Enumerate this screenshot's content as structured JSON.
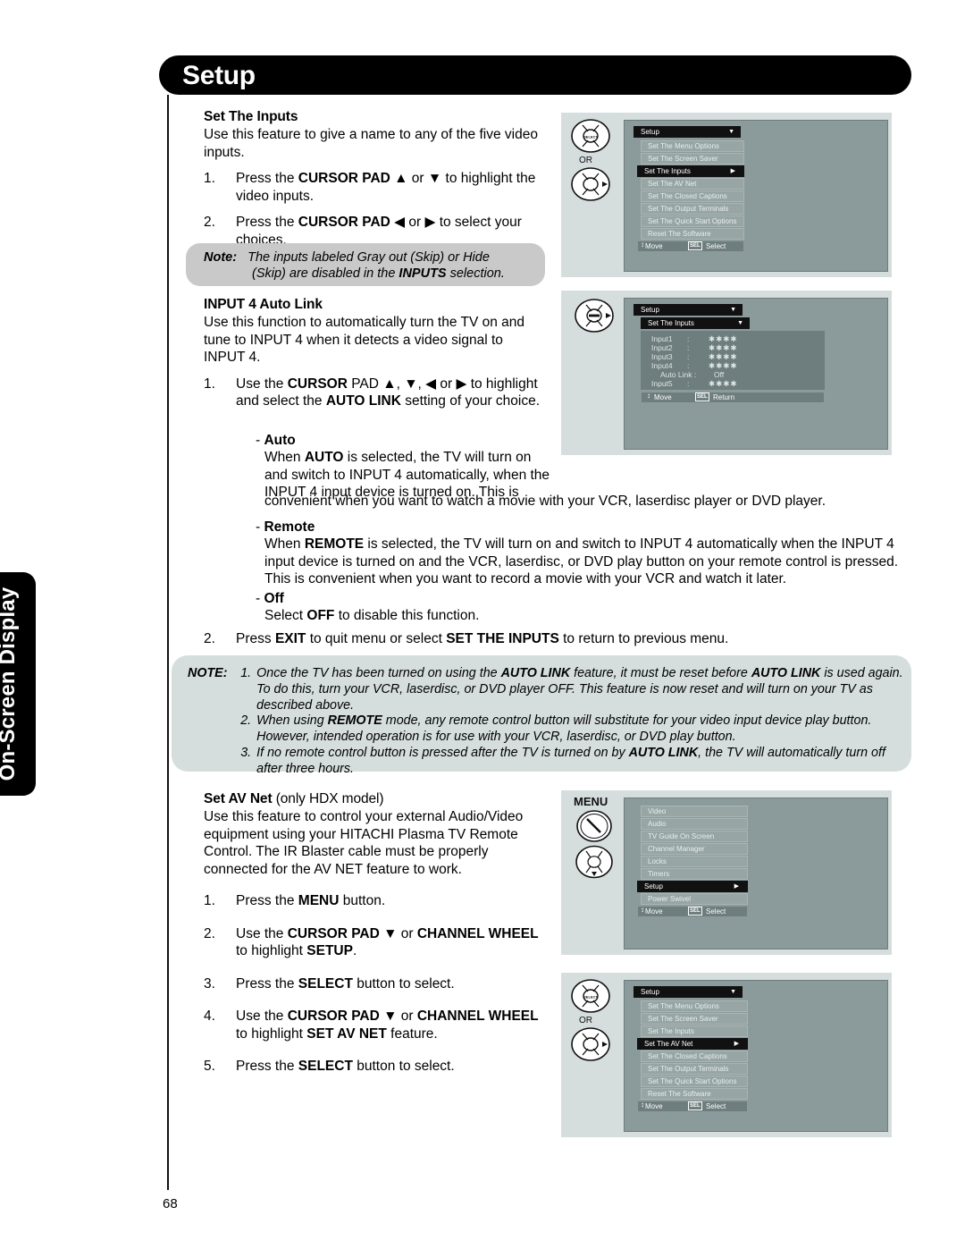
{
  "side_tab": {
    "label": "On-Screen Display"
  },
  "header": {
    "title": "Setup"
  },
  "page_number": "68",
  "content": {
    "set_inputs": {
      "heading": "Set The Inputs",
      "intro": "Use this feature to give a name to any of the five video inputs.",
      "steps": [
        {
          "num": "1.",
          "text_a": "Press the ",
          "bold_a": "CURSOR PAD",
          "text_b": " ▲ or ▼ to highlight the video inputs."
        },
        {
          "num": "2.",
          "text_a": "Press the ",
          "bold_a": "CURSOR PAD",
          "text_b": " ◀ or ▶ to select your choices."
        }
      ]
    },
    "note_bubble": {
      "label": "Note:",
      "line1": "The inputs labeled Gray out (Skip) or Hide",
      "line2_a": "(Skip) are disabled in the ",
      "line2_bold": "INPUTS",
      "line2_b": " selection."
    },
    "auto_link": {
      "heading": "INPUT 4 Auto Link",
      "intro": "Use this function to automatically turn the TV on and tune to INPUT 4 when it detects a video signal to INPUT 4.",
      "step1_num": "1.",
      "step1_a": "Use the ",
      "step1_bold1": "CURSOR",
      "step1_b": " PAD ▲, ▼, ◀ or ▶ to highlight and select the ",
      "step1_bold2": "AUTO LINK",
      "step1_c": " setting of your choice.",
      "options": [
        {
          "dash": "- ",
          "title": "Auto",
          "para_a": "When ",
          "para_bold": "AUTO",
          "para_b": " is selected, the TV will turn on and switch to INPUT 4 automatically, when the INPUT 4 input device is turned on. This is",
          "para_wide": "convenient when you want to watch a movie with your VCR, laserdisc player or DVD player."
        },
        {
          "dash": "- ",
          "title": "Remote",
          "para_a": "When ",
          "para_bold": "REMOTE",
          "para_b": " is selected, the TV will turn on and switch to INPUT 4 automatically when the INPUT 4 input device is turned on and the VCR, laserdisc, or DVD play button on your remote control is pressed. This is convenient when you want to record a movie with your VCR and watch it later."
        },
        {
          "dash": "- ",
          "title": "Off",
          "para_a": "Select ",
          "para_bold": "OFF",
          "para_b": " to disable this function."
        }
      ],
      "step2_num": "2.",
      "step2_a": "Press ",
      "step2_bold1": "EXIT",
      "step2_b": " to quit menu or select ",
      "step2_bold2": "SET THE INPUTS",
      "step2_c": " to return to previous menu."
    },
    "note_box": {
      "label": "NOTE:",
      "items": [
        {
          "num": "1.",
          "seg": [
            {
              "t": "Once the TV has been turned on using the ",
              "b": false
            },
            {
              "t": "AUTO LINK",
              "b": true
            },
            {
              "t": " feature, it must be reset before ",
              "b": false
            },
            {
              "t": "AUTO LINK",
              "b": true
            },
            {
              "t": " is used again. To do this, turn your VCR, laserdisc, or DVD player OFF. This feature is now reset and will turn on your TV as described above.",
              "b": false
            }
          ]
        },
        {
          "num": "2.",
          "seg": [
            {
              "t": "When using ",
              "b": false
            },
            {
              "t": "REMOTE",
              "b": true
            },
            {
              "t": " mode, any remote control button will substitute for your video input device play button. However, intended operation is for use with your VCR, laserdisc, or DVD play button.",
              "b": false
            }
          ]
        },
        {
          "num": "3.",
          "seg": [
            {
              "t": "If no remote control button is pressed after the TV is turned on by ",
              "b": false
            },
            {
              "t": "AUTO LINK",
              "b": true
            },
            {
              "t": ", the TV will automatically turn off after three hours.",
              "b": false
            }
          ]
        }
      ]
    },
    "av_net": {
      "heading_bold": "Set AV Net",
      "heading_reg": " (only HDX model)",
      "intro": "Use this feature to control your external Audio/Video equipment using your HITACHI Plasma TV Remote Control.  The IR Blaster cable must be properly connected for the AV NET feature to work.",
      "steps": [
        {
          "num": "1.",
          "a": "Press the ",
          "b1": "MENU",
          "b": " button."
        },
        {
          "num": "2.",
          "a": "Use the ",
          "b1": "CURSOR PAD ▼",
          "b": " or ",
          "b2": "CHANNEL WHEEL",
          "c": " to highlight ",
          "b3": "SETUP",
          "d": "."
        },
        {
          "num": "3.",
          "a": "Press the ",
          "b1": "SELECT",
          "b": " button to select."
        },
        {
          "num": "4.",
          "a": "Use the ",
          "b1": "CURSOR PAD ▼",
          "b": " or ",
          "b2": "CHANNEL WHEEL",
          "c": " to highlight ",
          "b3": "SET AV NET",
          "d": " feature."
        },
        {
          "num": "5.",
          "a": "Press the ",
          "b1": "SELECT",
          "b": " button to select."
        }
      ]
    }
  },
  "osd": {
    "graphic1": {
      "remote_or": "OR",
      "title": "Setup",
      "caret": "▼",
      "arrow": "▶",
      "items": [
        {
          "label": "Set The Menu Options",
          "selected": false
        },
        {
          "label": "Set The Screen Saver",
          "selected": false
        },
        {
          "label": "Set The Inputs",
          "selected": true
        },
        {
          "label": "Set  The AV Net",
          "selected": false
        },
        {
          "label": "Set The Closed Captions",
          "selected": false
        },
        {
          "label": "Set  The Output Terminals",
          "selected": false
        },
        {
          "label": "Set The Quick Start Options",
          "selected": false
        },
        {
          "label": "Reset The Software",
          "selected": false
        }
      ],
      "footer_move": "Move",
      "footer_badge": "SEL",
      "footer_action": "Select"
    },
    "graphic2": {
      "title": "Setup",
      "subtitle": "Set The Inputs",
      "caret": "▼",
      "rows": [
        {
          "name": "Input1",
          "colon": ":",
          "value": "✱✱✱✱",
          "sub": false
        },
        {
          "name": "Input2",
          "colon": ":",
          "value": "✱✱✱✱",
          "sub": false
        },
        {
          "name": "Input3",
          "colon": ":",
          "value": "✱✱✱✱",
          "sub": false
        },
        {
          "name": "Input4",
          "colon": ":",
          "value": "✱✱✱✱",
          "sub": false
        },
        {
          "name": "Auto Link :",
          "colon": "",
          "value": "Off",
          "sub": true
        },
        {
          "name": "Input5",
          "colon": ":",
          "value": "✱✱✱✱",
          "sub": false
        }
      ],
      "footer_move": "Move",
      "footer_badge": "SEL",
      "footer_action": "Return"
    },
    "graphic3": {
      "menu_word": "MENU",
      "items": [
        {
          "label": "Video",
          "selected": false
        },
        {
          "label": "Audio",
          "selected": false
        },
        {
          "label": "TV Guide On Screen",
          "selected": false
        },
        {
          "label": "Channel Manager",
          "selected": false
        },
        {
          "label": "Locks",
          "selected": false
        },
        {
          "label": "Timers",
          "selected": false
        },
        {
          "label": "Setup",
          "selected": true
        },
        {
          "label": "Power Swivel",
          "selected": false
        }
      ],
      "arrow": "▶",
      "footer_move": "Move",
      "footer_badge": "SEL",
      "footer_action": "Select"
    },
    "graphic4": {
      "remote_or": "OR",
      "title": "Setup",
      "caret": "▼",
      "arrow": "▶",
      "items": [
        {
          "label": "Set The Menu Options",
          "selected": false
        },
        {
          "label": "Set The Screen Saver",
          "selected": false
        },
        {
          "label": "Set The Inputs",
          "selected": false
        },
        {
          "label": "Set  The AV Net",
          "selected": true
        },
        {
          "label": "Set The Closed Captions",
          "selected": false
        },
        {
          "label": "Set  The Output Terminals",
          "selected": false
        },
        {
          "label": "Set The Quick Start Options",
          "selected": false
        },
        {
          "label": "Reset The Software",
          "selected": false
        }
      ],
      "footer_move": "Move",
      "footer_badge": "SEL",
      "footer_action": "Select"
    }
  },
  "colors": {
    "header_bg": "#000000",
    "panel_bg": "#d6dedd",
    "osd_screen": "#8b9a9a",
    "osd_row": "#97a5a5",
    "osd_selected": "#111111",
    "note_bubble": "#c9c9c9"
  }
}
